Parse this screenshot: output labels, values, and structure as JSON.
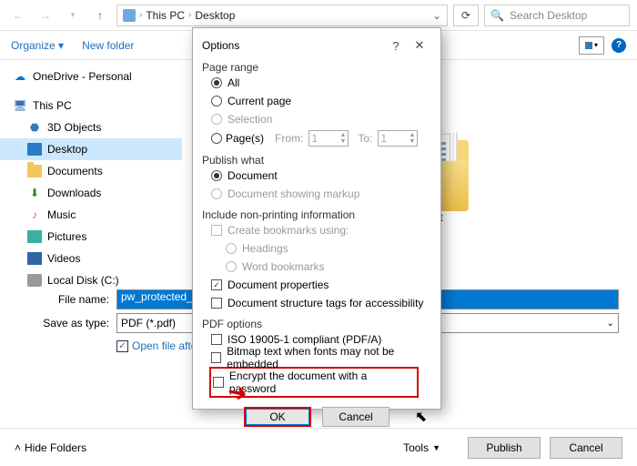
{
  "nav": {
    "crumb1": "This PC",
    "crumb2": "Desktop",
    "search_placeholder": "Search Desktop"
  },
  "toolbar": {
    "organize": "Organize",
    "newfolder": "New folder"
  },
  "tree": {
    "onedrive": "OneDrive - Personal",
    "thispc": "This PC",
    "objects3d": "3D Objects",
    "desktop": "Desktop",
    "documents": "Documents",
    "downloads": "Downloads",
    "music": "Music",
    "pictures": "Pictures",
    "videos": "Videos",
    "localdisk": "Local Disk (C:)"
  },
  "folder": {
    "name": "myProject"
  },
  "form": {
    "filename_label": "File name:",
    "filename_value": "pw_protected_pdf",
    "saveas_label": "Save as type:",
    "saveas_value": "PDF (*.pdf)",
    "openafter": "Open file after p"
  },
  "footer": {
    "hide": "Hide Folders",
    "tools": "Tools",
    "publish": "Publish",
    "cancel": "Cancel"
  },
  "dialog": {
    "title": "Options",
    "pagerange": "Page range",
    "all": "All",
    "currentpage": "Current page",
    "selection": "Selection",
    "pages": "Page(s)",
    "from": "From:",
    "to": "To:",
    "from_val": "1",
    "to_val": "1",
    "publishwhat": "Publish what",
    "document": "Document",
    "docmarkup": "Document showing markup",
    "includenp": "Include non-printing information",
    "createbm": "Create bookmarks using:",
    "headings": "Headings",
    "wordbm": "Word bookmarks",
    "docprops": "Document properties",
    "docstruct": "Document structure tags for accessibility",
    "pdfopts": "PDF options",
    "iso": "ISO 19005-1 compliant (PDF/A)",
    "bitmap": "Bitmap text when fonts may not be embedded",
    "encrypt": "Encrypt the document with a password",
    "ok": "OK",
    "cancel": "Cancel"
  }
}
